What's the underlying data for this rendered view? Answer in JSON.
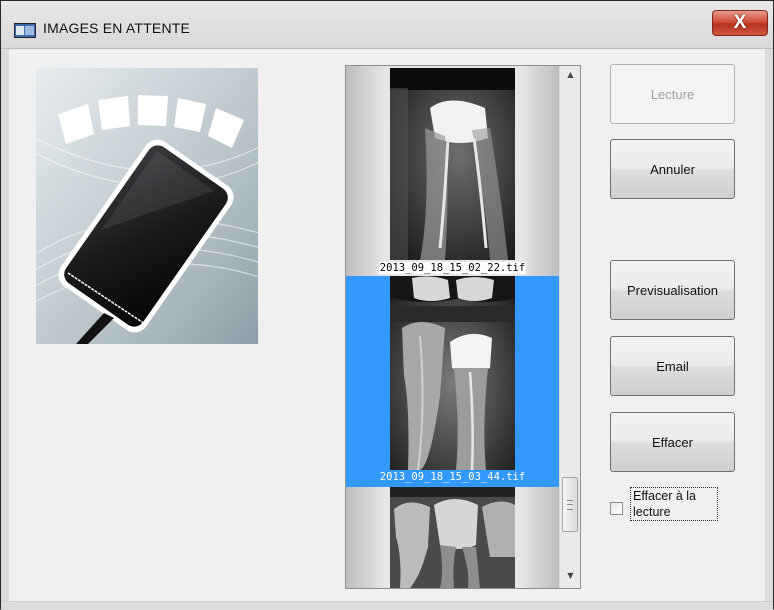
{
  "window": {
    "title": "IMAGES EN ATTENTE",
    "close_label": "X",
    "close_color": "#c7432e"
  },
  "thumbnails": [
    {
      "filename": "2013_09_18_15_02_22.tif",
      "selected": false
    },
    {
      "filename": "2013_09_18_15_03_44.tif",
      "selected": true
    },
    {
      "filename": "",
      "selected": false
    }
  ],
  "buttons": {
    "lecture": {
      "label": "Lecture",
      "enabled": false
    },
    "annuler": {
      "label": "Annuler",
      "enabled": true
    },
    "previsualisation": {
      "label": "Previsualisation",
      "enabled": true
    },
    "email": {
      "label": "Email",
      "enabled": true
    },
    "effacer": {
      "label": "Effacer",
      "enabled": true
    }
  },
  "checkbox": {
    "label": "Effacer à la lecture",
    "checked": false
  },
  "colors": {
    "selection": "#3399ff"
  },
  "icons": {
    "app": "app-window-icon",
    "scroll_up": "scroll-up-arrow-icon",
    "scroll_down": "scroll-down-arrow-icon"
  }
}
